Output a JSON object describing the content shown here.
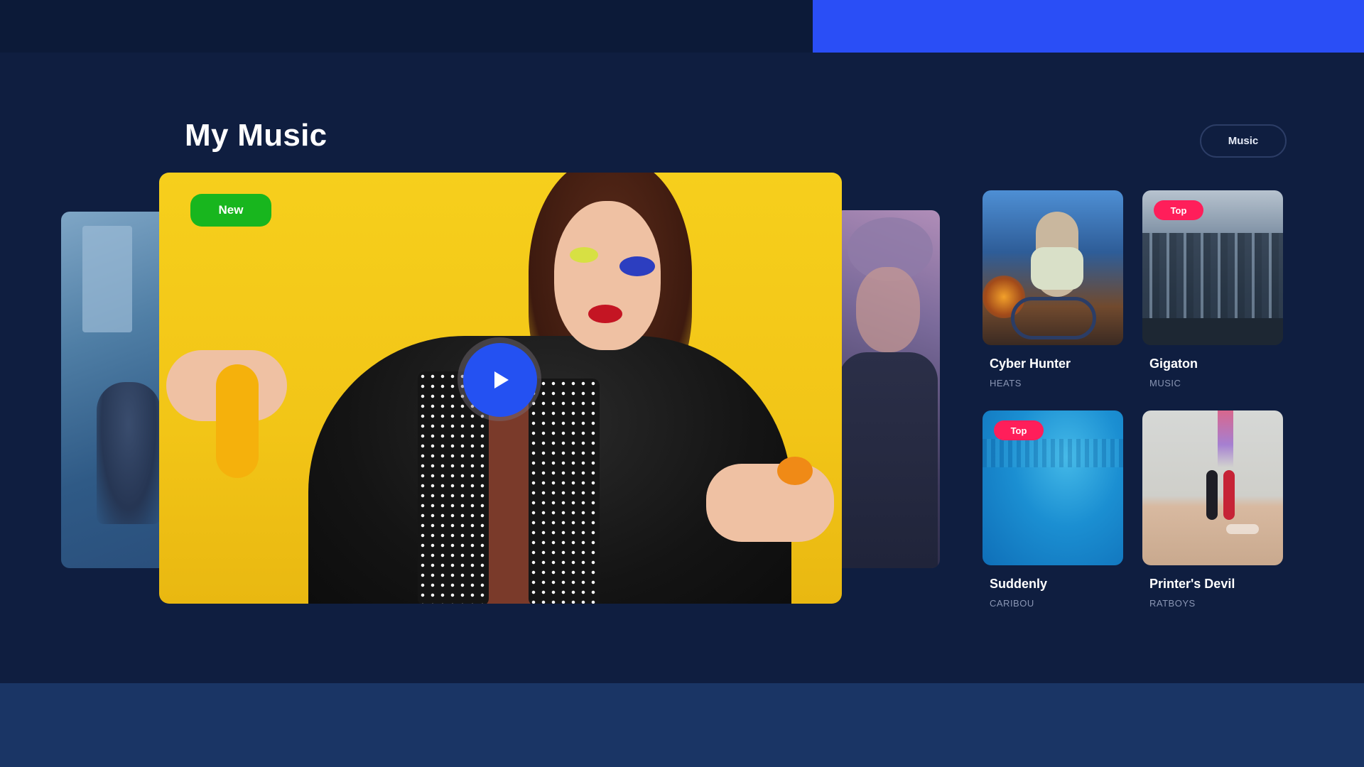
{
  "header": {
    "title": "My Music",
    "filter_button_label": "Music"
  },
  "featured": {
    "badge_label": "New",
    "play_icon": "play-icon"
  },
  "albums": [
    {
      "title": "Cyber Hunter",
      "artist": "HEATS",
      "badge": ""
    },
    {
      "title": "Gigaton",
      "artist": "MUSIC",
      "badge": "Top"
    },
    {
      "title": "Suddenly",
      "artist": "CARIBOU",
      "badge": "Top"
    },
    {
      "title": "Printer's Devil",
      "artist": "RATBOYS",
      "badge": ""
    }
  ],
  "colors": {
    "background": "#0f1e40",
    "accent_blue": "#2a4ef6",
    "new_badge": "#18b61e",
    "top_badge": "#ff1e5a",
    "play_button": "#2451f2",
    "secondary_text": "#8a96b4"
  }
}
